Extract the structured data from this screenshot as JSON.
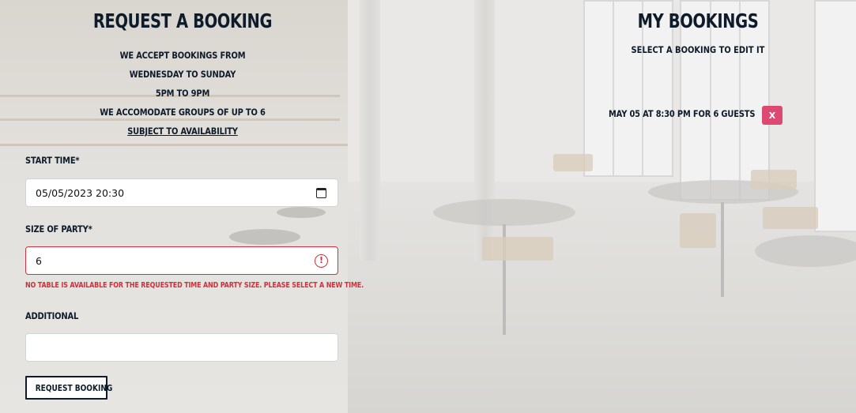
{
  "booking_form": {
    "title": "Request a booking",
    "info_lines": [
      "We accept bookings from",
      "Wednesday to Sunday",
      "5pm to 9pm",
      "We accomodate groups of up to 6"
    ],
    "availability_link": "Subject to availability",
    "start_time": {
      "label": "Start time*",
      "value": "05/05/2023 20:30",
      "icon": "calendar-icon"
    },
    "party_size": {
      "label": "Size of party*",
      "value": "6",
      "icon": "alert-icon",
      "error": "No table is available for the requested time and party size. Please select a new time."
    },
    "additional": {
      "label": "Additional",
      "value": ""
    },
    "submit_label": "Request booking"
  },
  "my_bookings": {
    "title": "My bookings",
    "subtitle": "Select a booking to edit it",
    "items": [
      {
        "text": "May 05 at 8:30 pm for 6 guests",
        "delete_label": "X"
      }
    ]
  },
  "colors": {
    "text": "#0d1b2a",
    "error": "#d0313c",
    "delete_button": "#dc4a73"
  }
}
